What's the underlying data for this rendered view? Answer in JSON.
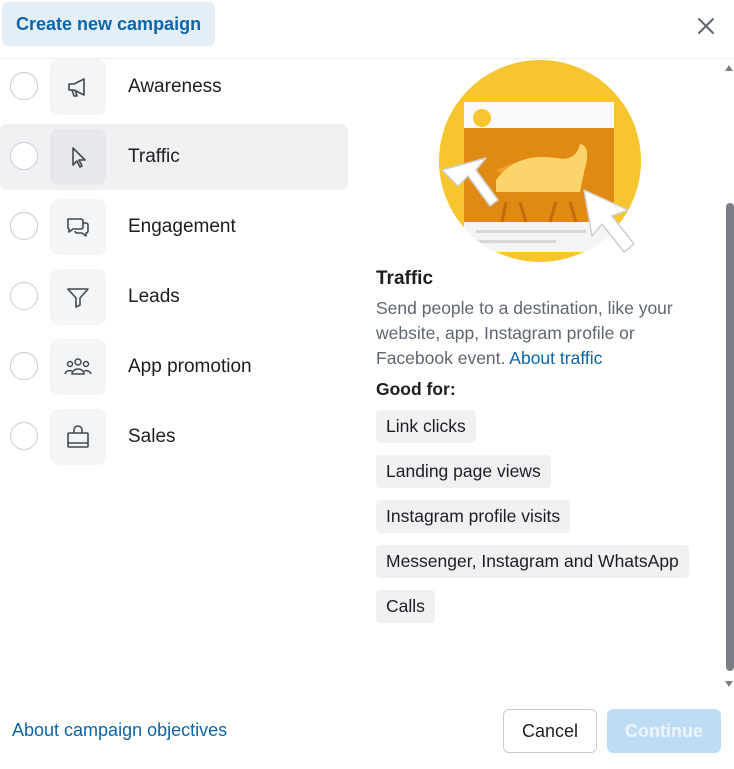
{
  "header": {
    "title": "Create new campaign"
  },
  "objectives": [
    {
      "label": "Awareness",
      "icon": "megaphone-icon",
      "selected": false
    },
    {
      "label": "Traffic",
      "icon": "cursor-icon",
      "selected": true
    },
    {
      "label": "Engagement",
      "icon": "chat-bubbles-icon",
      "selected": false
    },
    {
      "label": "Leads",
      "icon": "funnel-icon",
      "selected": false
    },
    {
      "label": "App promotion",
      "icon": "people-icon",
      "selected": false
    },
    {
      "label": "Sales",
      "icon": "shopping-bag-icon",
      "selected": false
    }
  ],
  "detail": {
    "title": "Traffic",
    "description": "Send people to a destination, like your website, app, Instagram profile or Facebook event.",
    "link": "About traffic",
    "good_for_label": "Good for:",
    "tags": [
      "Link clicks",
      "Landing page views",
      "Instagram profile visits",
      "Messenger, Instagram and WhatsApp",
      "Calls"
    ]
  },
  "footer": {
    "link": "About campaign objectives",
    "cancel_label": "Cancel",
    "continue_label": "Continue"
  },
  "colors": {
    "brand_blue": "#0a66a8",
    "illustration_yellow": "#f7c52d",
    "illustration_orange": "#e08a14",
    "continue_disabled": "#bfdcf5"
  }
}
